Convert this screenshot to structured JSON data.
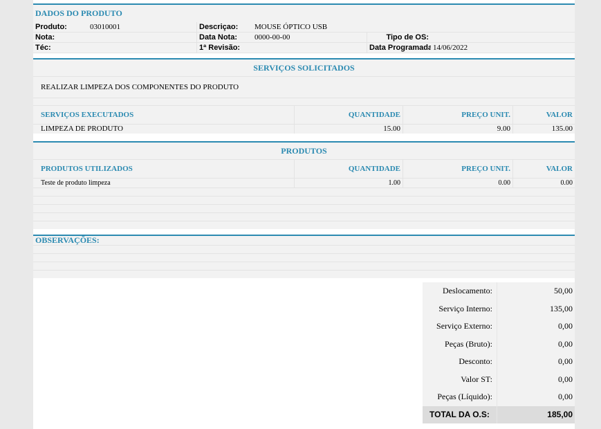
{
  "dados": {
    "title": "DADOS DO PRODUTO",
    "produto_label": "Produto:",
    "produto_value": "03010001",
    "descricao_label": "Descriçao:",
    "descricao_value": "MOUSE ÓPTICO USB",
    "nota_label": "Nota:",
    "nota_value": "",
    "data_nota_label": "Data Nota:",
    "data_nota_value": "0000-00-00",
    "tipo_os_label": "Tipo de OS:",
    "tipo_os_value": "",
    "tec_label": "Téc:",
    "tec_value": "",
    "revisao_label": "1ª Revisão:",
    "revisao_value": "",
    "data_programada_label": "Data Programada:",
    "data_programada_value": "14/06/2022"
  },
  "servicos": {
    "title": "SERVIÇOS SOLICITADOS",
    "descricao": "REALIZAR LIMPEZA DOS COMPONENTES DO PRODUTO",
    "headers": {
      "descricao": "SERVIÇOS EXECUTADOS",
      "quantidade": "QUANTIDADE",
      "preco": "PREÇO UNIT.",
      "valor": "VALOR"
    },
    "rows": [
      {
        "descricao": "LIMPEZA DE PRODUTO",
        "quantidade": "15.00",
        "preco": "9.00",
        "valor": "135.00"
      }
    ]
  },
  "produtos": {
    "title": "PRODUTOS",
    "headers": {
      "descricao": "PRODUTOS UTILIZADOS",
      "quantidade": "QUANTIDADE",
      "preco": "PREÇO UNIT.",
      "valor": "VALOR"
    },
    "rows": [
      {
        "descricao": "Teste de produto limpeza",
        "quantidade": "1.00",
        "preco": "0.00",
        "valor": "0.00"
      }
    ]
  },
  "observacoes": {
    "title": "OBSERVAÇÕES:"
  },
  "totais": {
    "deslocamento_label": "Deslocamento:",
    "deslocamento_value": "50,00",
    "servico_interno_label": "Serviço Interno:",
    "servico_interno_value": "135,00",
    "servico_externo_label": "Serviço Externo:",
    "servico_externo_value": "0,00",
    "pecas_bruto_label": "Peças (Bruto):",
    "pecas_bruto_value": "0,00",
    "desconto_label": "Desconto:",
    "desconto_value": "0,00",
    "valor_st_label": "Valor ST:",
    "valor_st_value": "0,00",
    "pecas_liquido_label": "Peças (Líquido):",
    "pecas_liquido_value": "0,00",
    "total_label": "TOTAL DA O.S:",
    "total_value": "185,00"
  },
  "colors": {
    "accent": "#2b8ab1",
    "panel": "#f2f2f2",
    "page_bg": "#e9e9e9"
  }
}
